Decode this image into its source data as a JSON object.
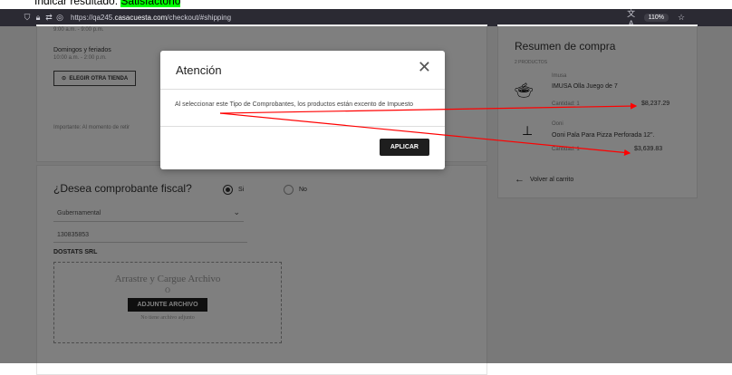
{
  "caption": {
    "prefix": "Indicar resultado:",
    "highlight": "Satisfactorio"
  },
  "browser": {
    "url_prefix": "https://qa245.",
    "url_domain": "casacuesta.com",
    "url_path": "/checkout/#shipping",
    "zoom": "110%"
  },
  "store": {
    "weekday_hours": "9:00 a.m. - 9:00 p.m.",
    "sunday_label": "Domingos y feriados",
    "sunday_hours": "10:00 a.m. - 2:00 p.m.",
    "choose_store_button": "ELEGIR OTRA TIENDA",
    "important_note": "Importante: Al momento de retir"
  },
  "fiscal": {
    "question": "¿Desea comprobante fiscal?",
    "yes_label": "Si",
    "no_label": "No",
    "type_selected": "Gubernamental",
    "rnc_value": "130835853",
    "company_name": "DOSTATS SRL",
    "upload_title": "Arrastre y Cargue Archivo",
    "upload_or": "O",
    "upload_button": "ADJUNTE ARCHIVO",
    "upload_status": "No tiene archivo adjunto"
  },
  "summary": {
    "title": "Resumen de compra",
    "count": "2 PRODUCTOS",
    "items": [
      {
        "brand": "Imusa",
        "name": "IMUSA Olla Juego de 7",
        "qty": "Cantidad: 1",
        "price": "$8,237.29"
      },
      {
        "brand": "Ooni",
        "name": "Ooni Pala Para Pizza Perforada 12\".",
        "qty": "Cantidad: 1",
        "price": "$3,639.83"
      }
    ],
    "back_link": "Volver al carrito"
  },
  "modal": {
    "title": "Atención",
    "body": "Al seleccionar este Tipo de Comprobantes, los productos están excento de Impuesto",
    "apply_button": "APLICAR"
  },
  "colors": {
    "highlight": "#00ff00",
    "annotation": "#ff0000",
    "overlay": "rgba(0,0,0,0.5)"
  }
}
